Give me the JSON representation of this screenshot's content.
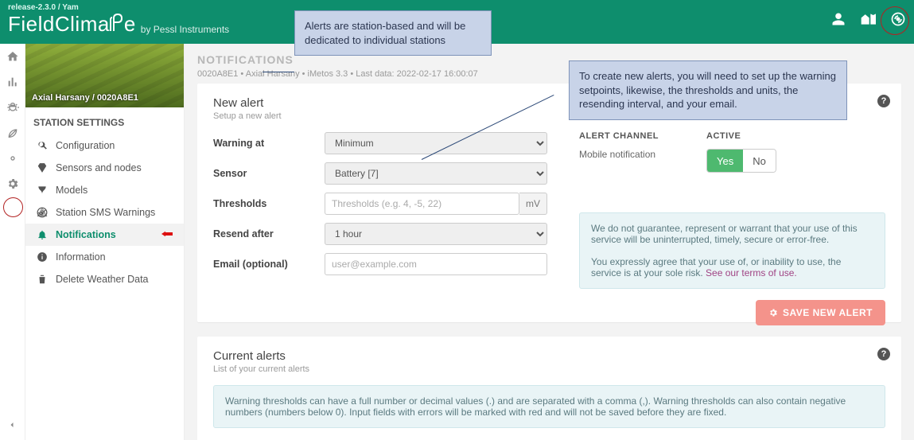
{
  "header": {
    "release": "release-2.3.0 / Yam",
    "brand_a": "Field",
    "brand_b": "Clima",
    "brand_c": "e",
    "byline": "by Pessl Instruments"
  },
  "sidebar": {
    "station": "Axial Harsany / 0020A8E1",
    "header": "STATION SETTINGS",
    "items": [
      {
        "label": "Configuration"
      },
      {
        "label": "Sensors and nodes"
      },
      {
        "label": "Models"
      },
      {
        "label": "Station SMS Warnings"
      },
      {
        "label": "Notifications"
      },
      {
        "label": "Information"
      },
      {
        "label": "Delete Weather Data"
      }
    ]
  },
  "crumbs": {
    "title": "NOTIFICATIONS",
    "sub": "0020A8E1 • Axial Harsany • iMetos 3.3 • Last data: 2022-02-17 16:00:07"
  },
  "newAlert": {
    "title": "New alert",
    "sub": "Setup a new alert",
    "labels": {
      "warning": "Warning at",
      "sensor": "Sensor",
      "thresholds": "Thresholds",
      "resend": "Resend after",
      "email": "Email (optional)"
    },
    "values": {
      "warning": "Minimum",
      "sensor": "Battery [7]",
      "thresholds_placeholder": "Thresholds (e.g. 4, -5, 22)",
      "thresholds_unit": "mV",
      "resend": "1 hour",
      "email_placeholder": "user@example.com"
    },
    "channel_label": "ALERT CHANNEL",
    "channel_value": "Mobile notification",
    "active_label": "ACTIVE",
    "active_yes": "Yes",
    "active_no": "No",
    "disclaimer1": "We do not guarantee, represent or warrant that your use of this service will be uninterrupted, timely, secure or error-free.",
    "disclaimer2": "You expressly agree that your use of, or inability to use, the service is at your sole risk. ",
    "disclaimer_link": "See our terms of use.",
    "save": "SAVE NEW ALERT"
  },
  "current": {
    "title": "Current alerts",
    "sub": "List of your current alerts",
    "info": "Warning thresholds can have a full number or decimal values (.) and are separated with a comma (,). Warning thresholds can also contain negative numbers (numbers below 0). Input fields with errors will be marked with red and will not be saved before they are fixed."
  },
  "callouts": {
    "c1": "Alerts are station-based and will be dedicated to individual stations",
    "c2": "To create new alerts, you will need to set up the warning setpoints, likewise, the thresholds and units, the resending interval, and your email."
  }
}
